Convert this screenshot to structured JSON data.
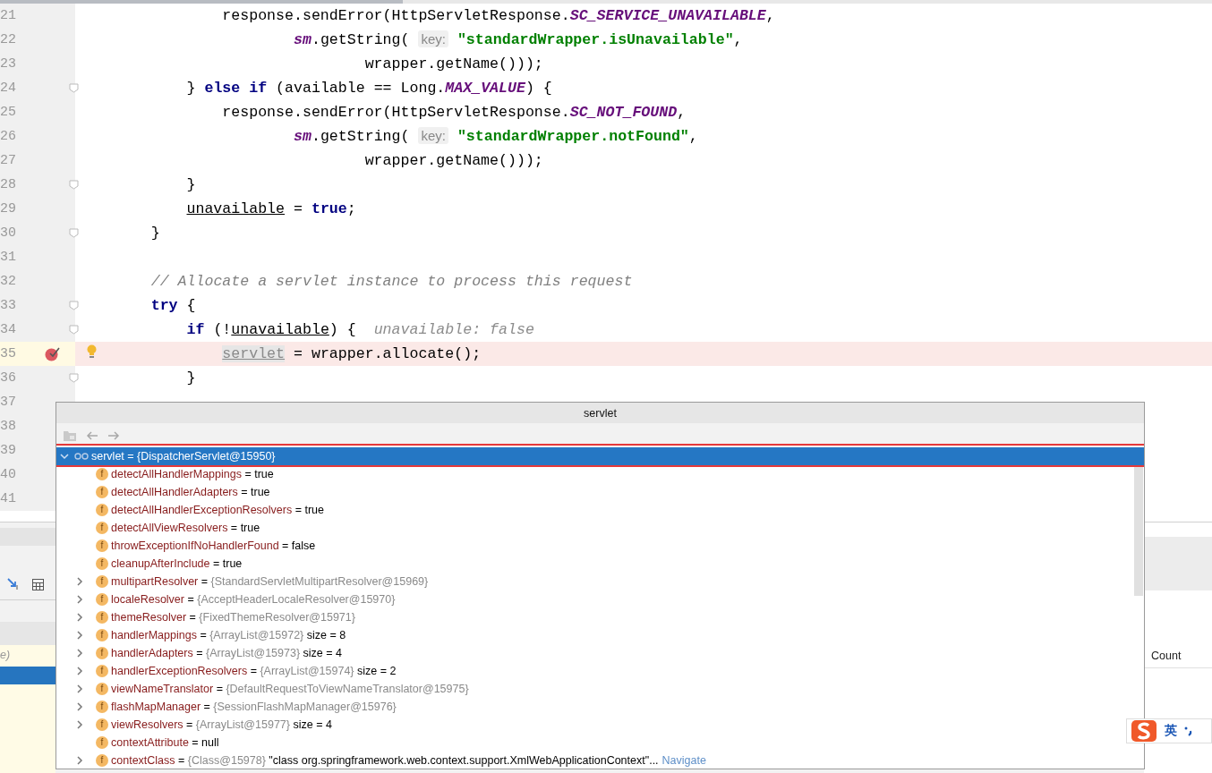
{
  "editor": {
    "lines": [
      {
        "number": "21",
        "segments": [
          {
            "kind": "plain",
            "text": "                response.sendError(HttpServletResponse."
          },
          {
            "kind": "constant",
            "text": "SC_SERVICE_UNAVAILABLE"
          },
          {
            "kind": "plain",
            "text": ","
          }
        ]
      },
      {
        "number": "22",
        "segments": [
          {
            "kind": "field",
            "text": "                        sm"
          },
          {
            "kind": "plain",
            "text": ".getString( "
          },
          {
            "kind": "hint",
            "text": "key:"
          },
          {
            "kind": "string",
            "text": " \"standardWrapper.isUnavailable\""
          },
          {
            "kind": "plain",
            "text": ","
          }
        ]
      },
      {
        "number": "23",
        "segments": [
          {
            "kind": "plain",
            "text": "                                wrapper.getName()));"
          }
        ]
      },
      {
        "number": "24",
        "fold": true,
        "segments": [
          {
            "kind": "plain",
            "text": "            } "
          },
          {
            "kind": "keyword",
            "text": "else if"
          },
          {
            "kind": "plain",
            "text": " (available == Long."
          },
          {
            "kind": "constant",
            "text": "MAX_VALUE"
          },
          {
            "kind": "plain",
            "text": ") {"
          }
        ]
      },
      {
        "number": "25",
        "segments": [
          {
            "kind": "plain",
            "text": "                response.sendError(HttpServletResponse."
          },
          {
            "kind": "constant",
            "text": "SC_NOT_FOUND"
          },
          {
            "kind": "plain",
            "text": ","
          }
        ]
      },
      {
        "number": "26",
        "segments": [
          {
            "kind": "field",
            "text": "                        sm"
          },
          {
            "kind": "plain",
            "text": ".getString( "
          },
          {
            "kind": "hint",
            "text": "key:"
          },
          {
            "kind": "string",
            "text": " \"standardWrapper.notFound\""
          },
          {
            "kind": "plain",
            "text": ","
          }
        ]
      },
      {
        "number": "27",
        "segments": [
          {
            "kind": "plain",
            "text": "                                wrapper.getName()));"
          }
        ]
      },
      {
        "number": "28",
        "fold": true,
        "segments": [
          {
            "kind": "plain",
            "text": "            }"
          }
        ]
      },
      {
        "number": "29",
        "segments": [
          {
            "kind": "variable",
            "text": "            unavailable"
          },
          {
            "kind": "plain",
            "text": " = "
          },
          {
            "kind": "keyword",
            "text": "true"
          },
          {
            "kind": "plain",
            "text": ";"
          }
        ]
      },
      {
        "number": "30",
        "fold": true,
        "segments": [
          {
            "kind": "plain",
            "text": "        }"
          }
        ]
      },
      {
        "number": "31"
      },
      {
        "number": "32",
        "segments": [
          {
            "kind": "comment",
            "text": "        // Allocate a servlet instance to process this request"
          }
        ]
      },
      {
        "number": "33",
        "fold": true,
        "segments": [
          {
            "kind": "keyword",
            "text": "        try"
          },
          {
            "kind": "plain",
            "text": " {"
          }
        ]
      },
      {
        "number": "34",
        "fold": true,
        "segments": [
          {
            "kind": "keyword",
            "text": "            if"
          },
          {
            "kind": "plain",
            "text": " (!"
          },
          {
            "kind": "variable",
            "text": "unavailable"
          },
          {
            "kind": "plain",
            "text": ") {  "
          },
          {
            "kind": "inline-value",
            "text": "unavailable: false"
          }
        ]
      },
      {
        "number": "35",
        "breakpoint": true,
        "current": true,
        "segments": [
          {
            "kind": "selected-variable",
            "text": "                servlet"
          },
          {
            "kind": "plain",
            "text": " = wrapper.allocate();"
          }
        ]
      },
      {
        "number": "36",
        "fold": true,
        "segments": [
          {
            "kind": "plain",
            "text": "            }"
          }
        ]
      },
      {
        "number": "37"
      },
      {
        "number": "38"
      },
      {
        "number": "39"
      },
      {
        "number": "40"
      },
      {
        "number": "41"
      }
    ]
  },
  "popup": {
    "title": "servlet",
    "root": {
      "text": "servlet = {DispatcherServlet@15950}",
      "expanded": true,
      "selected": true
    },
    "fields": [
      {
        "kind": "primitive",
        "icon": "f",
        "name": "detectAllHandlerMappings",
        "value": "= true"
      },
      {
        "kind": "primitive",
        "icon": "f",
        "name": "detectAllHandlerAdapters",
        "value": "= true"
      },
      {
        "kind": "primitive",
        "icon": "f",
        "name": "detectAllHandlerExceptionResolvers",
        "value": "= true"
      },
      {
        "kind": "primitive",
        "icon": "f",
        "name": "detectAllViewResolvers",
        "value": "= true"
      },
      {
        "kind": "primitive",
        "icon": "f",
        "name": "throwExceptionIfNoHandlerFound",
        "value": "= false"
      },
      {
        "kind": "primitive",
        "icon": "f",
        "name": "cleanupAfterInclude",
        "value": "= true"
      },
      {
        "kind": "object",
        "icon": "f",
        "name": "multipartResolver",
        "assign": "=",
        "ref": "{StandardServletMultipartResolver@15969}",
        "expanded": false
      },
      {
        "kind": "object",
        "icon": "f",
        "name": "localeResolver",
        "assign": "=",
        "ref": "{AcceptHeaderLocaleResolver@15970}",
        "expanded": false
      },
      {
        "kind": "object",
        "icon": "f",
        "name": "themeResolver",
        "assign": "=",
        "ref": "{FixedThemeResolver@15971}",
        "expanded": false
      },
      {
        "kind": "object",
        "icon": "f",
        "name": "handlerMappings",
        "assign": "=",
        "ref": "{ArrayList@15972}",
        "extra": "size = 8",
        "expanded": false
      },
      {
        "kind": "object",
        "icon": "f",
        "name": "handlerAdapters",
        "assign": "=",
        "ref": "{ArrayList@15973}",
        "extra": "size = 4",
        "expanded": false
      },
      {
        "kind": "object",
        "icon": "f",
        "name": "handlerExceptionResolvers",
        "assign": "=",
        "ref": "{ArrayList@15974}",
        "extra": "size = 2",
        "expanded": false
      },
      {
        "kind": "object",
        "icon": "f",
        "name": "viewNameTranslator",
        "assign": "=",
        "ref": "{DefaultRequestToViewNameTranslator@15975}",
        "expanded": false
      },
      {
        "kind": "object",
        "icon": "f",
        "name": "flashMapManager",
        "assign": "=",
        "ref": "{SessionFlashMapManager@15976}",
        "expanded": false
      },
      {
        "kind": "object",
        "icon": "f",
        "name": "viewResolvers",
        "assign": "=",
        "ref": "{ArrayList@15977}",
        "extra": "size = 4",
        "expanded": false
      },
      {
        "kind": "primitive",
        "icon": "f",
        "name": "contextAttribute",
        "value": "= null"
      },
      {
        "kind": "object",
        "icon": "f",
        "name": "contextClass",
        "assign": "=",
        "ref": "{Class@15978}",
        "extra": "\"class org.springframework.web.context.support.XmlWebApplicationContext\"...",
        "link": "Navigate",
        "expanded": false
      }
    ]
  },
  "side_panel": {
    "row_text": "e)",
    "column_header": "Count"
  },
  "ime_toolbar": {
    "mode": "英"
  }
}
